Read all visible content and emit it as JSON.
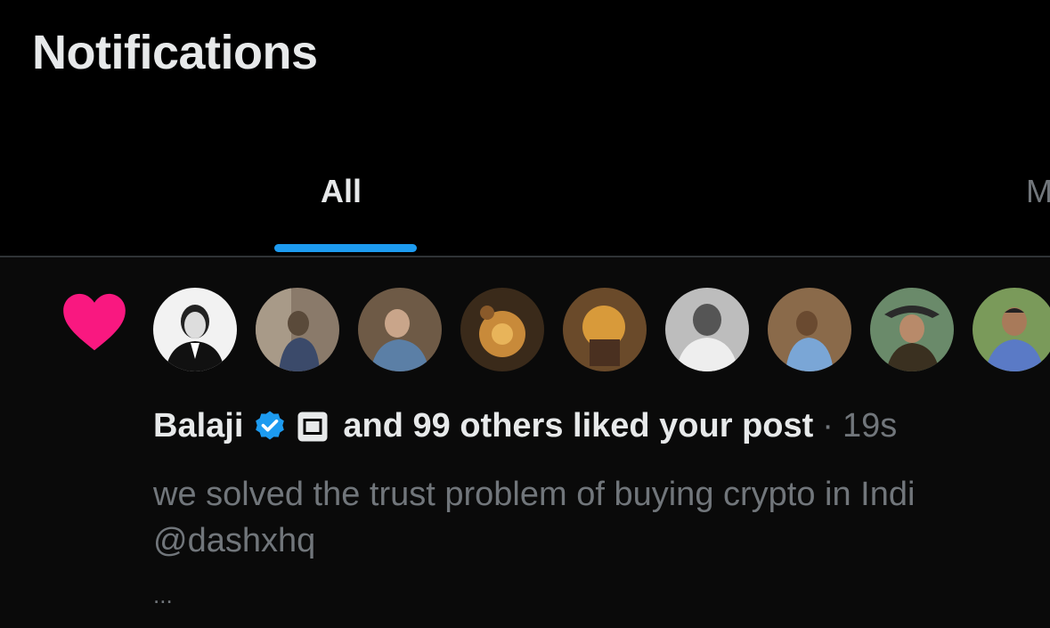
{
  "header": {
    "title": "Notifications"
  },
  "tabs": [
    {
      "label": "All",
      "active": true
    },
    {
      "label": "M",
      "active": false
    }
  ],
  "notification": {
    "type_icon": "heart-icon",
    "heart_color": "#f91880",
    "avatar_count_visible": 9,
    "actor_name": "Balaji",
    "actor_badge": "verified-badge-icon",
    "action_text": "and 99 others liked your post",
    "separator": "·",
    "time_ago": "19s",
    "post_text_lines": [
      "we solved the trust problem of buying crypto in Indi",
      "@dashxhq"
    ],
    "more_indicator": "..."
  },
  "colors": {
    "background": "#000000",
    "accent": "#1d9bf0",
    "muted_text": "#71767b",
    "primary_text": "#e7e9ea"
  }
}
